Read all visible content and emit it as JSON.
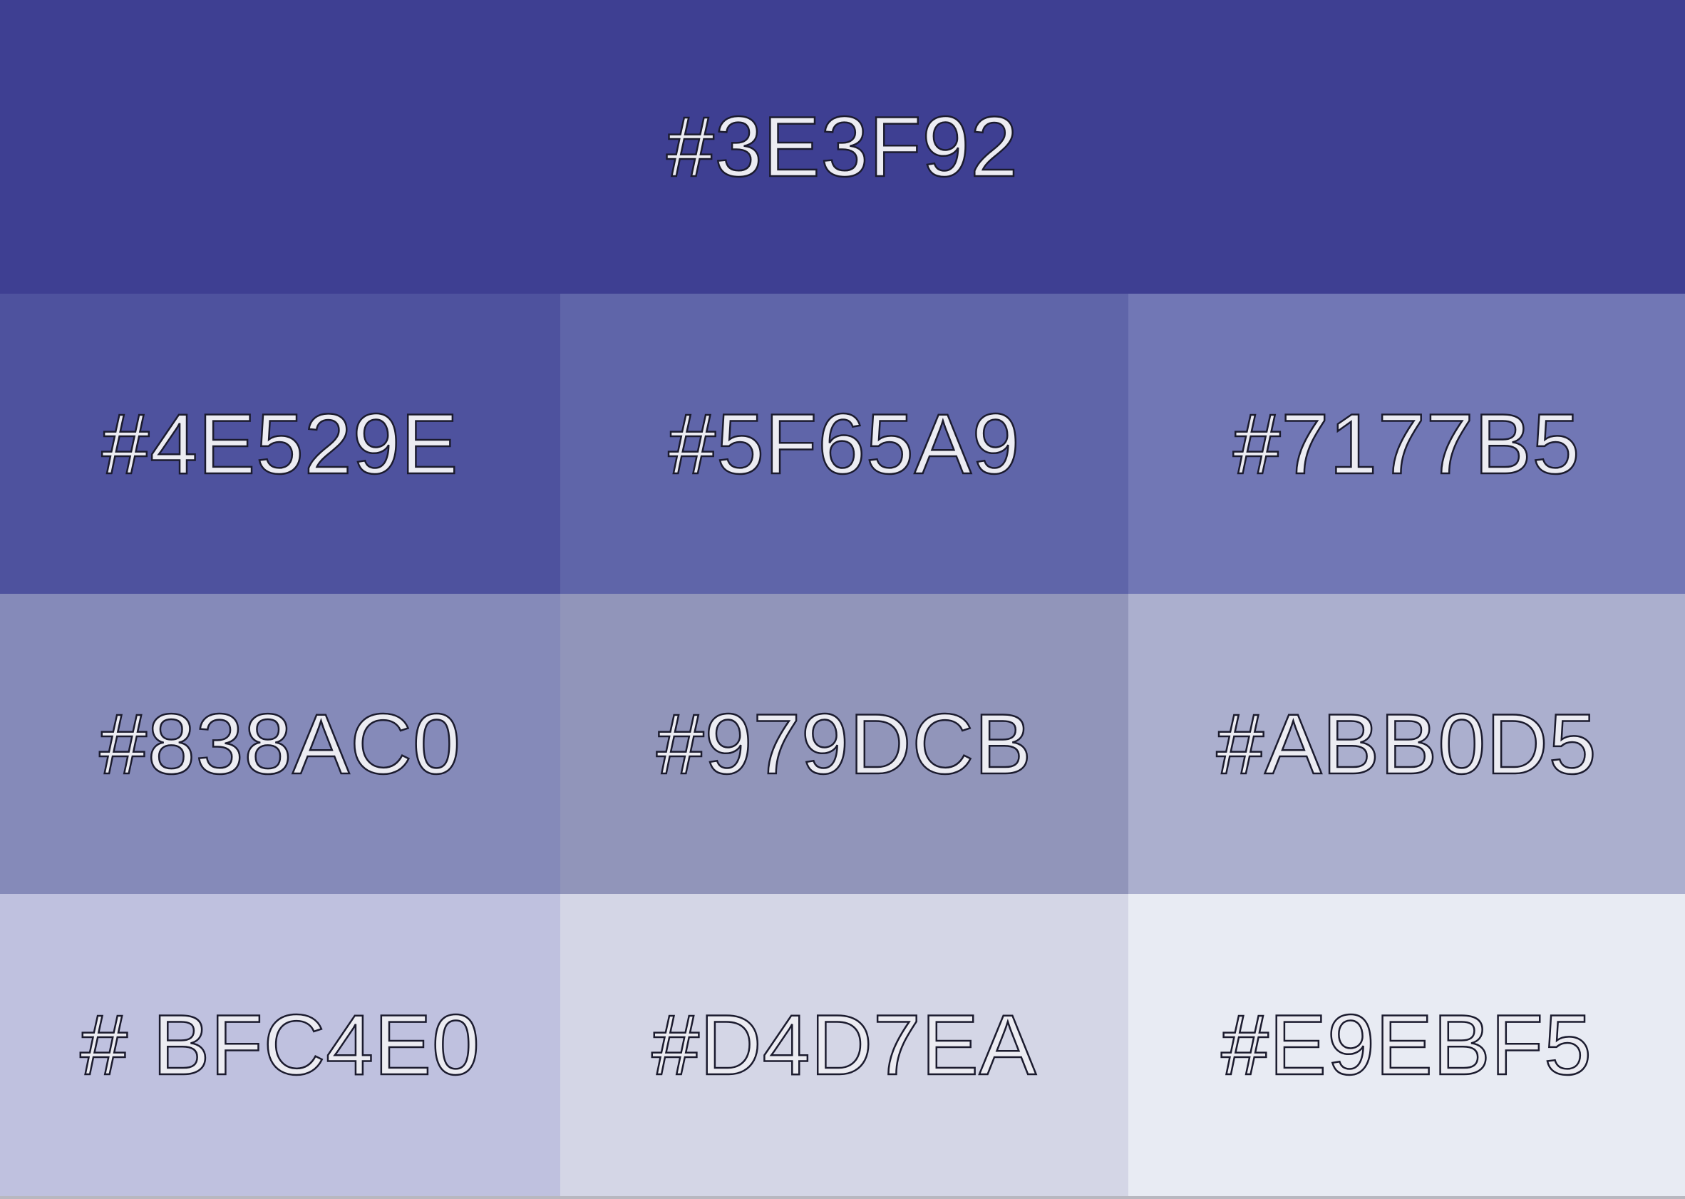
{
  "palette": {
    "swatches": [
      {
        "label": "#3E3F92",
        "color": "#3E3F92"
      },
      {
        "label": "#4E529E",
        "color": "#4E529E"
      },
      {
        "label": "#5F65A9",
        "color": "#5F65A9"
      },
      {
        "label": "#7177B5",
        "color": "#7177B5"
      },
      {
        "label": "#838AC0",
        "color": "#858AB9"
      },
      {
        "label": "#979DCB",
        "color": "#9195BA"
      },
      {
        "label": "#ABB0D5",
        "color": "#ABAFCE"
      },
      {
        "label": "# BFC4E0",
        "color": "#BFC1DF"
      },
      {
        "label": "#D4D7EA",
        "color": "#D4D6E6"
      },
      {
        "label": "#E9EBF5",
        "color": "#E8EBF3"
      }
    ]
  }
}
